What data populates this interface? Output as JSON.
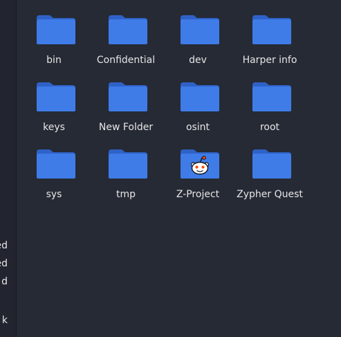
{
  "sidebar": {
    "items": [
      {
        "label": "ed",
        "icon": "sidebar-item-fragment"
      },
      {
        "label": "ed",
        "icon": "sidebar-item-fragment"
      },
      {
        "label": "d",
        "icon": "sidebar-item-fragment"
      },
      {
        "label": "k",
        "icon": "sidebar-item-fragment"
      }
    ]
  },
  "files": [
    {
      "name": "bin",
      "icon": "folder-icon"
    },
    {
      "name": "Confidential",
      "icon": "folder-icon"
    },
    {
      "name": "dev",
      "icon": "folder-icon"
    },
    {
      "name": "Harper info",
      "icon": "folder-icon"
    },
    {
      "name": "keys",
      "icon": "folder-icon"
    },
    {
      "name": "New Folder",
      "icon": "folder-icon"
    },
    {
      "name": "osint",
      "icon": "folder-icon"
    },
    {
      "name": "root",
      "icon": "folder-icon"
    },
    {
      "name": "sys",
      "icon": "folder-icon"
    },
    {
      "name": "tmp",
      "icon": "folder-icon"
    },
    {
      "name": "Z-Project",
      "icon": "reddit-folder-icon"
    },
    {
      "name": "Zypher Quest",
      "icon": "folder-icon"
    }
  ],
  "colors": {
    "background": "#262a35",
    "sidebar": "#22252f",
    "folder_back": "#2f62c7",
    "folder_front": "#3f7ce8",
    "text": "#e6e6e6",
    "badge_red": "#ff4500"
  }
}
